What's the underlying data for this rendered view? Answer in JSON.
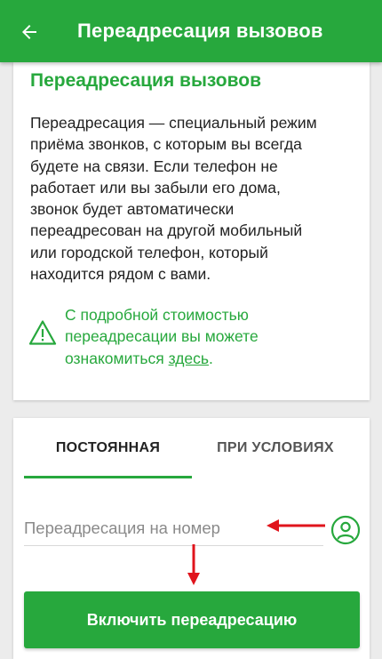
{
  "app_bar": {
    "title": "Переадресация вызовов",
    "back_icon": "arrow-left-icon",
    "background": "#27a83d"
  },
  "info_card": {
    "heading": "Переадресация вызовов",
    "body_lines": [
      "Переадресация — специальный режим",
      "приёма звонков, с которым вы всегда",
      "будете на связи. Если телефон не",
      "работает или вы забыли его дома,",
      "звонок будет автоматически",
      "переадресован на другой мобильный",
      "или городской телефон, который",
      "находится рядом с вами."
    ],
    "notice": {
      "icon": "warning-icon",
      "line1": "С подробной стоимостью",
      "line2": "переадресации вы можете",
      "line3_prefix": "ознакомиться ",
      "link_text": "здесь",
      "line3_suffix": "."
    }
  },
  "form_card": {
    "tabs": [
      {
        "label": "ПОСТОЯННАЯ",
        "active": true
      },
      {
        "label": "ПРИ УСЛОВИЯХ",
        "active": false
      }
    ],
    "phone_input": {
      "placeholder": "Переадресация на номер",
      "value": ""
    },
    "contact_icon": "person-circle-icon",
    "enable_button_label": "Включить переадресацию"
  },
  "annotations": {
    "arrow_color": "#e0141c"
  }
}
